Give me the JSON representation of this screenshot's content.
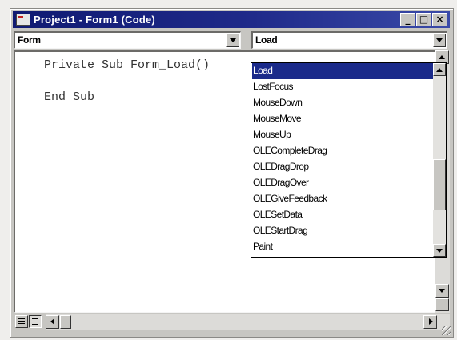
{
  "window": {
    "title": "Project1 - Form1 (Code)",
    "buttons": {
      "minimize": "_",
      "maximize": "□",
      "close": "×"
    }
  },
  "object_combo": {
    "value": "Form"
  },
  "procedure_combo": {
    "value": "Load"
  },
  "code": {
    "lines": [
      "Private Sub Form_Load()",
      "End Sub"
    ]
  },
  "procedure_dropdown": {
    "items": [
      "Load",
      "LostFocus",
      "MouseDown",
      "MouseMove",
      "MouseUp",
      "OLECompleteDrag",
      "OLEDragDrop",
      "OLEDragOver",
      "OLEGiveFeedback",
      "OLESetData",
      "OLEStartDrag",
      "Paint"
    ],
    "selected_index": 0
  },
  "colors": {
    "titlebar": "#101a72",
    "selection": "#1a2a8a",
    "chrome": "#c7c6c2"
  }
}
